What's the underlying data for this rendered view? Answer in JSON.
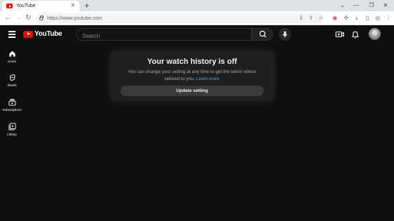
{
  "browser": {
    "tab_title": "YouTube",
    "url": "https://www.youtube.com"
  },
  "masthead": {
    "logo_text": "YouTube",
    "search_placeholder": "Search"
  },
  "sidebar": {
    "items": [
      {
        "label": "Home",
        "icon": "home-icon"
      },
      {
        "label": "Shorts",
        "icon": "shorts-icon"
      },
      {
        "label": "Subscriptions",
        "icon": "subscriptions-icon"
      },
      {
        "label": "Library",
        "icon": "library-icon"
      }
    ]
  },
  "card": {
    "title": "Your watch history is off",
    "message": "You can change your setting at any time to get the latest videos tailored to you.",
    "link": "Learn more",
    "button": "Update setting"
  },
  "colors": {
    "background": "#0f0f0f",
    "brand_red": "#ff0000",
    "link_blue": "#3ea6ff"
  }
}
